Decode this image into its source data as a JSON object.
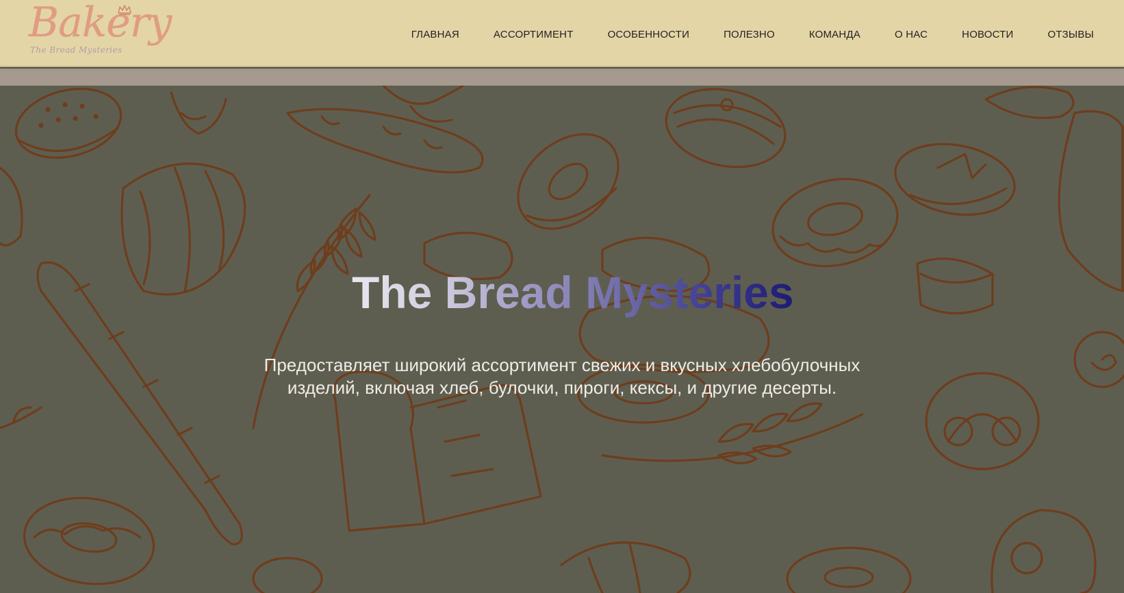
{
  "header": {
    "logo": {
      "word": "Bakery",
      "tagline": "The Bread Mysteries"
    },
    "nav": [
      {
        "label": "ГЛАВНАЯ",
        "icon": "nav-link"
      },
      {
        "label": "АССОРТИМЕНТ",
        "icon": "nav-link"
      },
      {
        "label": "ОСОБЕННОСТИ",
        "icon": "nav-link"
      },
      {
        "label": "ПОЛЕЗНО",
        "icon": "nav-link"
      },
      {
        "label": "КОМАНДА",
        "icon": "nav-link"
      },
      {
        "label": "О НАС",
        "icon": "nav-link"
      },
      {
        "label": "НОВОСТИ",
        "icon": "nav-link"
      },
      {
        "label": "ОТЗЫВЫ",
        "icon": "nav-link"
      }
    ]
  },
  "hero": {
    "title": "The Bread Mysteries",
    "subtitle": "Предоставляет широкий ассортимент свежих и вкусных хлебобулочных изделий, включая хлеб, булочки, пироги, кексы, и другие десерты."
  },
  "colors": {
    "header_bg": "#e4d5a7",
    "band": "#a69a8e",
    "hero_bg": "#5e5e50",
    "doodle_stroke": "#6e3d1d",
    "logo": "#e09a80",
    "title_gradient_start": "#e8e6ee",
    "title_gradient_end": "#1c1a72",
    "subtitle": "#f1ece6"
  }
}
